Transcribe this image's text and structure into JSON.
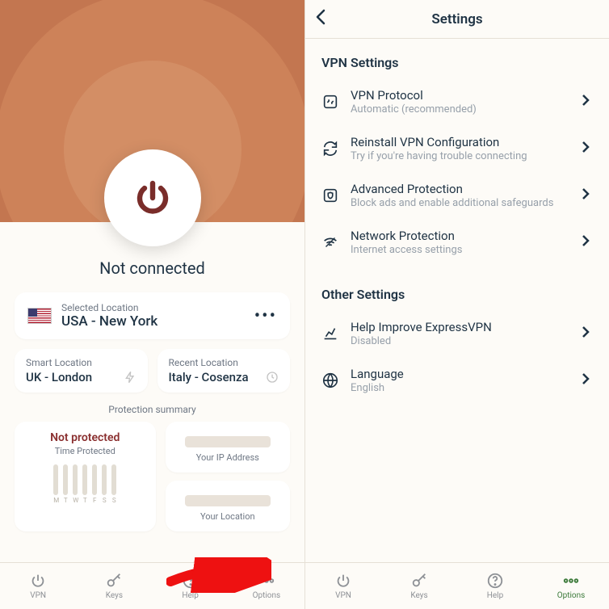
{
  "left": {
    "status": "Not connected",
    "selected_location_label": "Selected Location",
    "selected_location_value": "USA - New York",
    "smart_label": "Smart Location",
    "smart_value": "UK - London",
    "recent_label": "Recent Location",
    "recent_value": "Italy - Cosenza",
    "protection_summary_title": "Protection summary",
    "not_protected_title": "Not protected",
    "time_protected_label": "Time Protected",
    "day_labels": [
      "M",
      "T",
      "W",
      "T",
      "F",
      "S",
      "S"
    ],
    "ip_label": "Your IP Address",
    "loc_label": "Your Location",
    "nav": {
      "vpn": "VPN",
      "keys": "Keys",
      "help": "Help",
      "options": "Options"
    }
  },
  "right": {
    "title": "Settings",
    "sections": [
      {
        "title": "VPN Settings",
        "items": [
          {
            "icon": "protocol",
            "title": "VPN Protocol",
            "sub": "Automatic (recommended)"
          },
          {
            "icon": "reinstall",
            "title": "Reinstall VPN Configuration",
            "sub": "Try if you're having trouble connecting"
          },
          {
            "icon": "shield",
            "title": "Advanced Protection",
            "sub": "Block ads and enable additional safeguards"
          },
          {
            "icon": "wifi",
            "title": "Network Protection",
            "sub": "Internet access settings"
          }
        ]
      },
      {
        "title": "Other Settings",
        "items": [
          {
            "icon": "chart",
            "title": "Help Improve ExpressVPN",
            "sub": "Disabled"
          },
          {
            "icon": "globe",
            "title": "Language",
            "sub": "English"
          }
        ]
      }
    ]
  }
}
